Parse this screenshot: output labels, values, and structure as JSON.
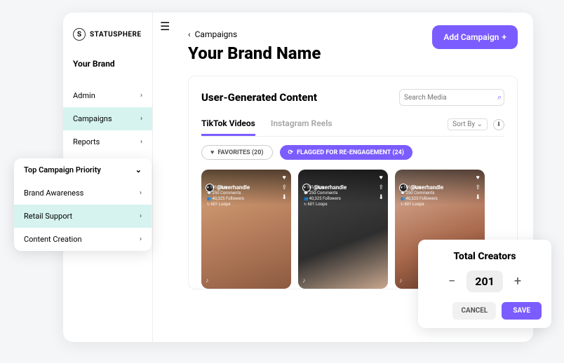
{
  "brand": {
    "logo_letter": "S",
    "name": "STATUSPHERE"
  },
  "sidebar": {
    "your_brand_label": "Your Brand",
    "items": [
      {
        "label": "Admin",
        "active": false
      },
      {
        "label": "Campaigns",
        "active": true
      },
      {
        "label": "Reports",
        "active": false
      }
    ]
  },
  "header": {
    "hamburger_icon": "hamburger-icon",
    "back_label": "Campaigns",
    "page_title": "Your Brand Name",
    "add_campaign_label": "Add Campaign",
    "add_icon": "+"
  },
  "content": {
    "card_title": "User-Generated Content",
    "search_placeholder": "Search Media",
    "tabs": [
      {
        "label": "TikTok Videos",
        "active": true
      },
      {
        "label": "Instagram Reels",
        "active": false
      }
    ],
    "sort_by_label": "Sort By",
    "download_icon": "download-icon",
    "filters": {
      "favorites_label": "FAVORITES (20)",
      "flagged_label": "FLAGGED FOR RE-ENGAGEMENT (24)"
    },
    "videos": [
      {
        "handle": "@userhandle",
        "likes": "101 Likes",
        "comments": "250 Comments",
        "followers": "40,325 Followers",
        "loops": "601 Loops"
      },
      {
        "handle": "@userhandle",
        "likes": "101 Likes",
        "comments": "250 Comments",
        "followers": "40,325 Followers",
        "loops": "601 Loops"
      },
      {
        "handle": "@userhandle",
        "likes": "101 Likes",
        "comments": "250 Comments",
        "followers": "40,325 Followers",
        "loops": "601 Loops"
      }
    ]
  },
  "priority": {
    "header_label": "Top Campaign Priority",
    "items": [
      {
        "label": "Brand Awareness",
        "active": false
      },
      {
        "label": "Retail Support",
        "active": true
      },
      {
        "label": "Content Creation",
        "active": false
      }
    ]
  },
  "creators": {
    "title": "Total Creators",
    "value": "201",
    "cancel_label": "CANCEL",
    "save_label": "SAVE"
  }
}
